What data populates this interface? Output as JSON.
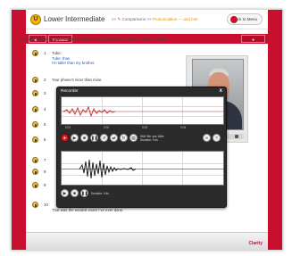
{
  "header": {
    "level_icon": "U",
    "level_title": "Lower Intermediate",
    "crumb_sep": ">>",
    "crumb_comparisons": "Comparisons",
    "crumb_pronunciation": "Pronunciation — and me!",
    "back_to_menu": "Back to Menu"
  },
  "nav": {
    "back": "◄ Back",
    "forward": "Forward ►",
    "record": "● Record"
  },
  "instruction": "Learn about how we pronounce comparatives and superlatives. Click to start the video.",
  "rows": [
    {
      "num": "1",
      "line1": "Tube:",
      "line2": "Tube: than",
      "line3": "I'm taller than my brother."
    },
    {
      "num": "2",
      "line1": "Your phone's nicer than mine."
    },
    {
      "num": "3",
      "line1": ""
    },
    {
      "num": "4",
      "line1": ""
    },
    {
      "num": "5",
      "line1": ""
    },
    {
      "num": "6",
      "line1": ""
    },
    {
      "num": "7",
      "line1": ""
    },
    {
      "num": "8",
      "line1": ""
    },
    {
      "num": "9",
      "line1": ""
    },
    {
      "num": "10",
      "line1": "That was the easiest exam I've ever done."
    }
  ],
  "recorder": {
    "title": "Recorder",
    "close": "x",
    "ticks": [
      "0:01",
      "0:02",
      "0:03",
      "0:04"
    ],
    "info1": "WAV file: yes 16kb",
    "info2": "Duration: 0:4s",
    "info3": "Duration: 0:4s"
  },
  "footer": {
    "brand": "Clarity"
  },
  "colors": {
    "brand_red": "#c8102e",
    "recorder_bg": "#2b2b2b",
    "waveform": "#c22b2b",
    "waveform_model": "#111111"
  },
  "icons": {
    "logo": "level-badge-icon",
    "speaker": "speaker-icon",
    "record": "record-icon",
    "play": "play-icon",
    "stop": "stop-icon",
    "pause": "pause-icon",
    "help": "help-icon",
    "link": "link-icon"
  }
}
